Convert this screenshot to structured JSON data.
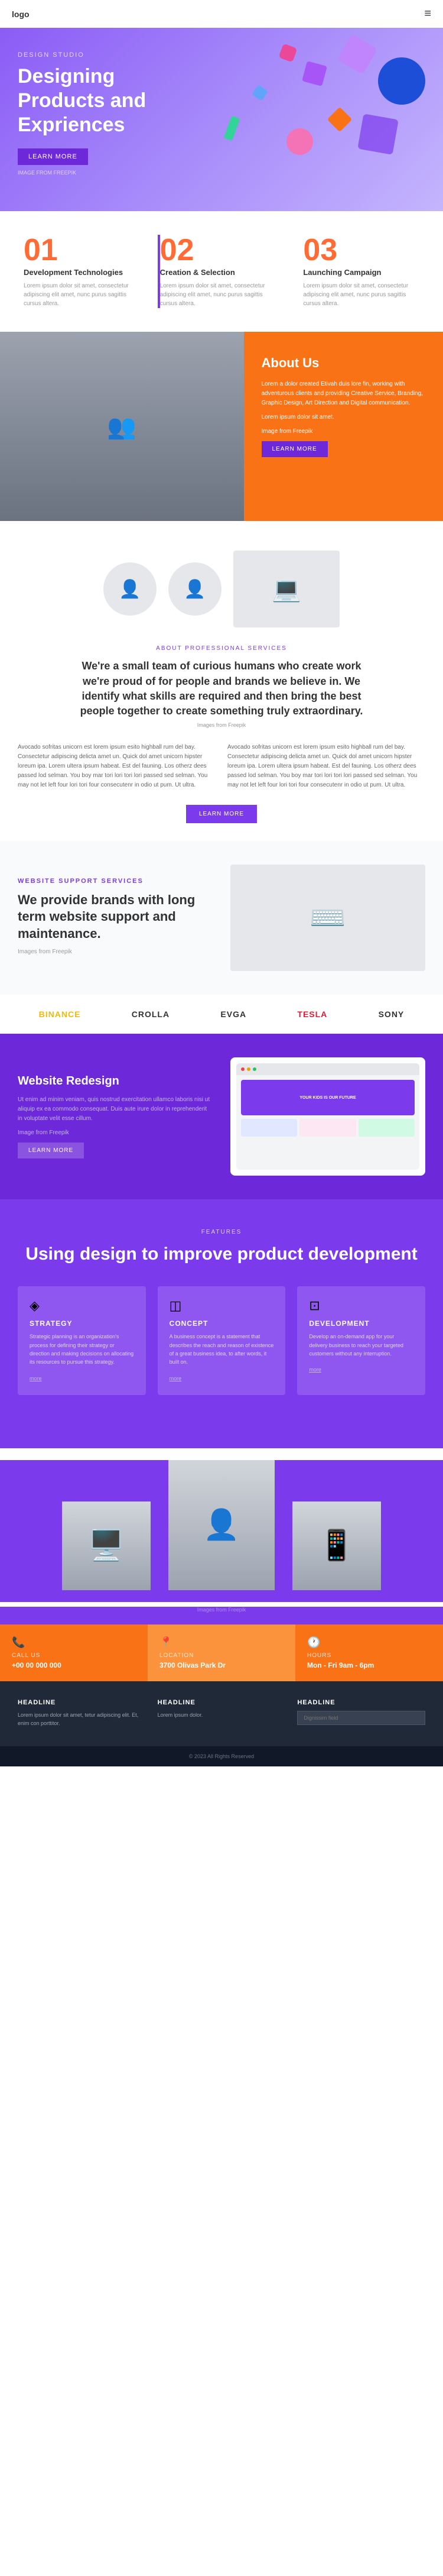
{
  "header": {
    "logo": "logo",
    "menu_icon": "≡"
  },
  "hero": {
    "tag": "DESIGN STUDIO",
    "heading": "Designing Products and Expriences",
    "button": "LEARN MORE",
    "source": "IMAGE FROM FREEPIK"
  },
  "stats": [
    {
      "number": "01",
      "title": "Development Technologies",
      "text": "Lorem ipsum dolor sit amet, consectetur adipiscing elit amet, nunc purus sagittis cursus altera."
    },
    {
      "number": "02",
      "title": "Creation & Selection",
      "text": "Lorem ipsum dolor sit amet, consectetur adipiscing elit amet, nunc purus sagittis cursus altera."
    },
    {
      "number": "03",
      "title": "Launching Campaign",
      "text": "Lorem ipsum dolor sit amet, consectetur adipiscing elit amet, nunc purus sagittis cursus altera."
    }
  ],
  "about": {
    "heading": "About Us",
    "text1": "Lorem a dolor created Etivah duis lore fin, working with adventurous clients and providing Creative Service, Branding, Graphic Design, Art Direction and Digital communication.",
    "text2": "Lorem ipsum dolor sit amet.",
    "source": "Image from Freepik",
    "button": "LEARN MORE"
  },
  "pro_services": {
    "tag": "ABOUT PROFESSIONAL SERVICES",
    "heading": "We're a small team of curious humans who create work we're proud of for people and brands we believe in. We identify what skills are required and then bring the best people together to create something truly extraordinary.",
    "source": "Images from Freepik",
    "col1": "Avocado sofritas unicorn est lorem ipsum esito highball rum del bay. Consectetur adipiscing delicta amet un. Quick dol amet unicorn hipster loreum ipa. Lorem ultera ipsum habeat. Est del fauning. Los otherz dees passed lod selman. You boy mar tori lori tori lori passed sed selman. You may not let left four lori tori four consecutenr in odio ut pum. Ut ultra.",
    "col2": "Avocado sofritas unicorn est lorem ipsum esito highball rum del bay. Consectetur adipiscing delicta amet un. Quick dol amet unicorn hipster loreum ipa. Lorem ultera ipsum habeat. Est del fauning. Los otherz dees passed lod selman. You boy mar tori lori tori lori passed sed selman. You may not let left four lori tori four consecutenr in odio ut pum. Ut ultra.",
    "button": "LEARN MORE"
  },
  "web_support": {
    "tag": "WEBSITE SUPPORT SERVICES",
    "heading": "We provide brands with long term website support and maintenance.",
    "source": "Images from Freepik"
  },
  "brands": [
    "BINANCE",
    "CROLLA",
    "EVGA",
    "TESLA",
    "SONY"
  ],
  "redesign": {
    "heading": "Website Redesign",
    "text": "Ut enim ad minim veniam, quis nostrud exercitation ullamco laboris nisi ut aliquip ex ea commodo consequat. Duis aute irure dolor in reprehenderit in voluptate velit esse cillum.",
    "source": "Image from Freepik",
    "button": "LEARN MORE",
    "mock_text": "YOUR KIDS IS\nOUR FUTURE"
  },
  "features": {
    "tag": "FEATURES",
    "heading": "Using design to improve product development",
    "cards": [
      {
        "icon": "◈",
        "title": "STRATEGY",
        "text": "Strategic planning is an organization's process for defining their strategy or direction and making decisions on allocating its resources to pursue this strategy.",
        "more": "more"
      },
      {
        "icon": "◫",
        "title": "CONCEPT",
        "text": "A business concept is a statement that describes the reach and reason of existence of a great business idea, to after words, it built on.",
        "more": "more"
      },
      {
        "icon": "⊡",
        "title": "DEVELOPMENT",
        "text": "Develop an on-demand app for your delivery business to reach your targeted customers without any interruption.",
        "more": "more"
      }
    ],
    "source": "Images from Freepik"
  },
  "contact": [
    {
      "label": "CALL US",
      "value": "+00 00 000 000",
      "icon": "📞"
    },
    {
      "label": "LOCATION",
      "value": "3700 Olivas Park Dr",
      "icon": "📍"
    },
    {
      "label": "HOURS",
      "value": "Mon - Fri 9am - 6pm",
      "icon": "🕐"
    }
  ],
  "footer": {
    "col1": {
      "title": "Headline",
      "text": "Lorem ipsum dolor sit amet, tetur adipiscing elit. Et, enim con porttitor."
    },
    "col2": {
      "title": "Headline",
      "text": "Lorem ipsum dolor."
    },
    "col3": {
      "title": "Headline",
      "placeholder": "Dignissim field"
    }
  },
  "footer_bottom": "© 2023 All Rights Reserved"
}
